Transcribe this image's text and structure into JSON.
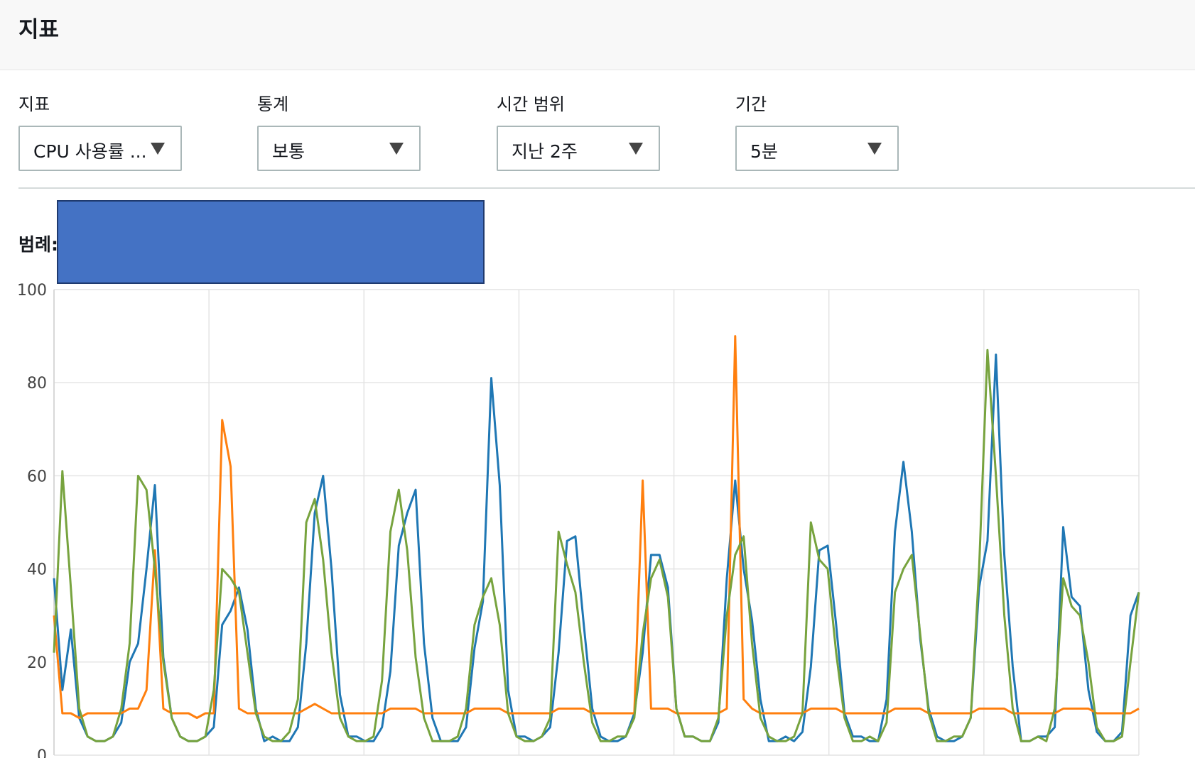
{
  "page": {
    "title": "지표"
  },
  "controls": [
    {
      "label": "지표",
      "value": "CPU 사용률 ..."
    },
    {
      "label": "통계",
      "value": "보통"
    },
    {
      "label": "시간 범위",
      "value": "지난 2주"
    },
    {
      "label": "기간",
      "value": "5분"
    }
  ],
  "legend": {
    "label": "범례:"
  },
  "chart_data": {
    "type": "line",
    "title": "",
    "xlabel": "",
    "ylabel": "",
    "ylim": [
      0,
      100
    ],
    "y_ticks": [
      0,
      20,
      40,
      60,
      80,
      100
    ],
    "x_divisions": 7,
    "grid": true,
    "series": [
      {
        "color": "#1f77b4",
        "values": [
          38,
          14,
          27,
          8,
          4,
          3,
          3,
          4,
          7,
          20,
          24,
          40,
          58,
          21,
          8,
          4,
          3,
          3,
          4,
          6,
          28,
          31,
          36,
          27,
          10,
          3,
          4,
          3,
          3,
          6,
          24,
          52,
          60,
          40,
          13,
          4,
          4,
          3,
          3,
          6,
          18,
          45,
          52,
          57,
          24,
          8,
          3,
          3,
          3,
          6,
          23,
          33,
          81,
          58,
          14,
          4,
          4,
          3,
          4,
          6,
          22,
          46,
          47,
          28,
          10,
          4,
          3,
          3,
          4,
          9,
          22,
          43,
          43,
          36,
          10,
          4,
          4,
          3,
          3,
          7,
          38,
          59,
          40,
          29,
          12,
          3,
          3,
          4,
          3,
          5,
          19,
          44,
          45,
          28,
          9,
          4,
          4,
          3,
          3,
          12,
          48,
          63,
          48,
          25,
          10,
          4,
          3,
          3,
          4,
          8,
          36,
          46,
          86,
          43,
          19,
          3,
          3,
          4,
          4,
          6,
          49,
          34,
          32,
          14,
          5,
          3,
          3,
          5,
          30,
          35
        ]
      },
      {
        "color": "#ff7f0e",
        "values": [
          30,
          9,
          9,
          8,
          9,
          9,
          9,
          9,
          9,
          10,
          10,
          14,
          44,
          10,
          9,
          9,
          9,
          8,
          9,
          9,
          72,
          62,
          10,
          9,
          9,
          9,
          9,
          9,
          9,
          9,
          10,
          11,
          10,
          9,
          9,
          9,
          9,
          9,
          9,
          9,
          10,
          10,
          10,
          10,
          9,
          9,
          9,
          9,
          9,
          9,
          10,
          10,
          10,
          10,
          9,
          9,
          9,
          9,
          9,
          9,
          10,
          10,
          10,
          10,
          9,
          9,
          9,
          9,
          9,
          9,
          59,
          10,
          10,
          10,
          9,
          9,
          9,
          9,
          9,
          9,
          10,
          90,
          12,
          10,
          9,
          9,
          9,
          9,
          9,
          9,
          10,
          10,
          10,
          10,
          9,
          9,
          9,
          9,
          9,
          9,
          10,
          10,
          10,
          10,
          9,
          9,
          9,
          9,
          9,
          9,
          10,
          10,
          10,
          10,
          9,
          9,
          9,
          9,
          9,
          9,
          10,
          10,
          10,
          10,
          9,
          9,
          9,
          9,
          9,
          10
        ]
      },
      {
        "color": "#77a33e",
        "values": [
          22,
          61,
          36,
          10,
          4,
          3,
          3,
          4,
          10,
          24,
          60,
          57,
          40,
          20,
          8,
          4,
          3,
          3,
          4,
          14,
          40,
          38,
          35,
          22,
          9,
          4,
          3,
          3,
          5,
          12,
          50,
          55,
          42,
          22,
          8,
          4,
          3,
          3,
          4,
          16,
          48,
          57,
          44,
          21,
          8,
          3,
          3,
          3,
          4,
          10,
          28,
          34,
          38,
          28,
          9,
          4,
          3,
          3,
          4,
          8,
          48,
          41,
          35,
          20,
          7,
          3,
          3,
          4,
          4,
          8,
          26,
          38,
          42,
          34,
          10,
          4,
          4,
          3,
          3,
          8,
          30,
          43,
          47,
          24,
          8,
          4,
          3,
          3,
          4,
          9,
          50,
          42,
          40,
          22,
          8,
          3,
          3,
          4,
          3,
          7,
          35,
          40,
          43,
          26,
          9,
          3,
          3,
          4,
          4,
          8,
          40,
          87,
          60,
          30,
          10,
          3,
          3,
          4,
          3,
          10,
          38,
          32,
          30,
          20,
          6,
          3,
          3,
          4,
          20,
          35
        ]
      }
    ]
  }
}
